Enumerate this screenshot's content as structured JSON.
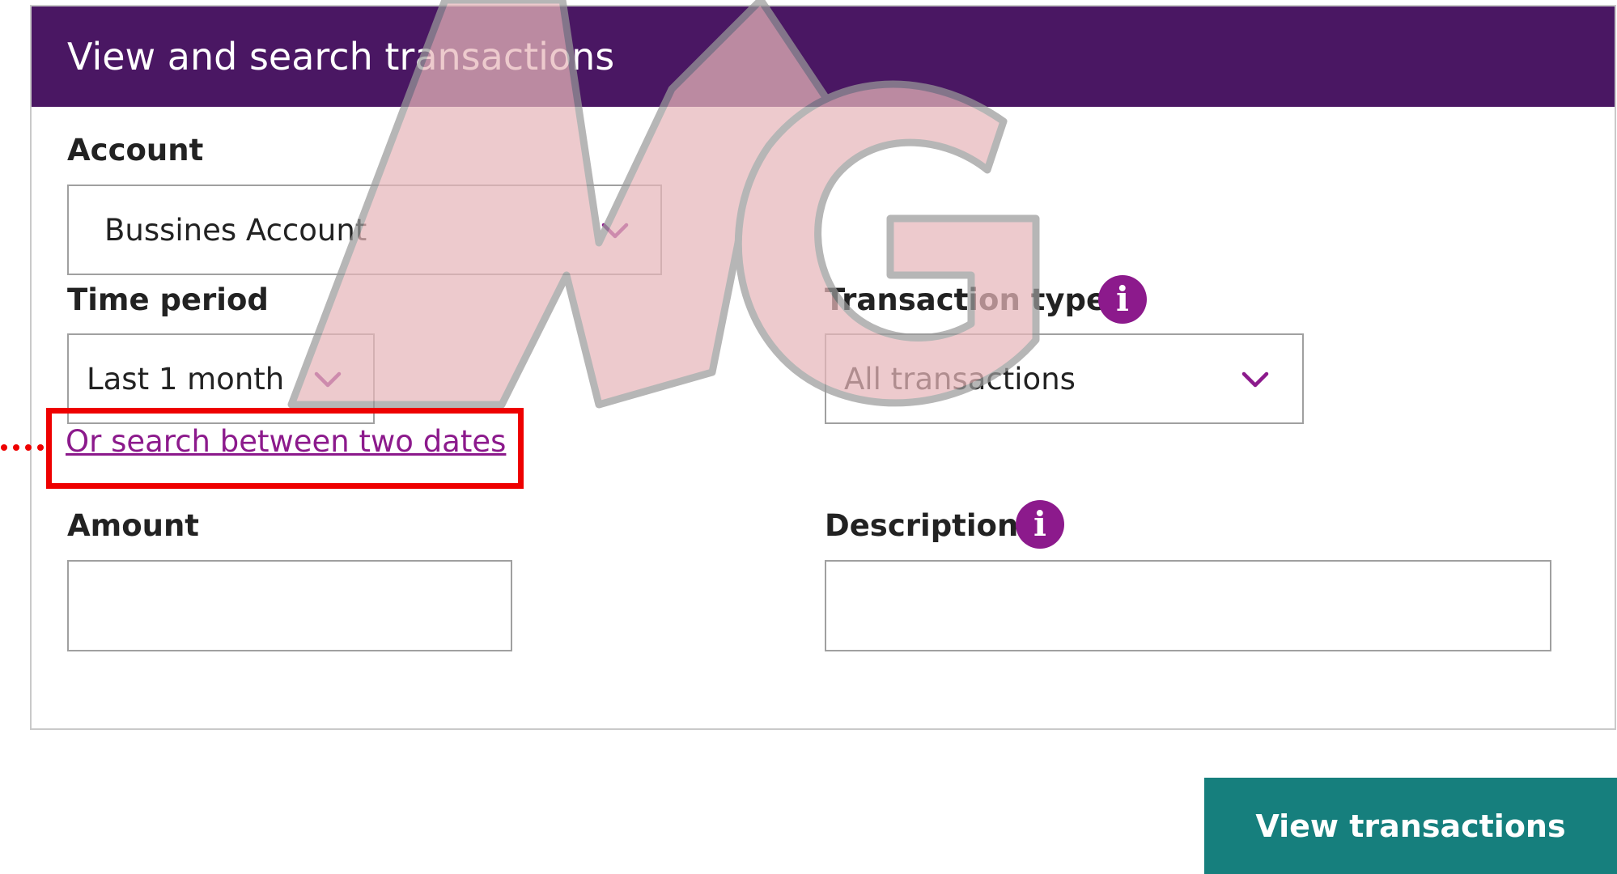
{
  "panel": {
    "title": "View and search transactions"
  },
  "account": {
    "label": "Account",
    "value": "Bussines Account"
  },
  "time_period": {
    "label": "Time period",
    "value": "Last 1 month",
    "link": "Or search between two dates"
  },
  "transaction_type": {
    "label": "Transaction type",
    "value": "All transactions"
  },
  "amount": {
    "label": "Amount",
    "value": ""
  },
  "description": {
    "label": "Description",
    "value": ""
  },
  "actions": {
    "view_label": "View transactions"
  },
  "watermark": {
    "text": "MG"
  },
  "colors": {
    "header": "#4a1763",
    "accent": "#8c1a8c",
    "button": "#167f7d",
    "highlight": "#ee0000"
  },
  "icons": {
    "chevron": "chevron-down-icon",
    "info": "info-icon"
  }
}
